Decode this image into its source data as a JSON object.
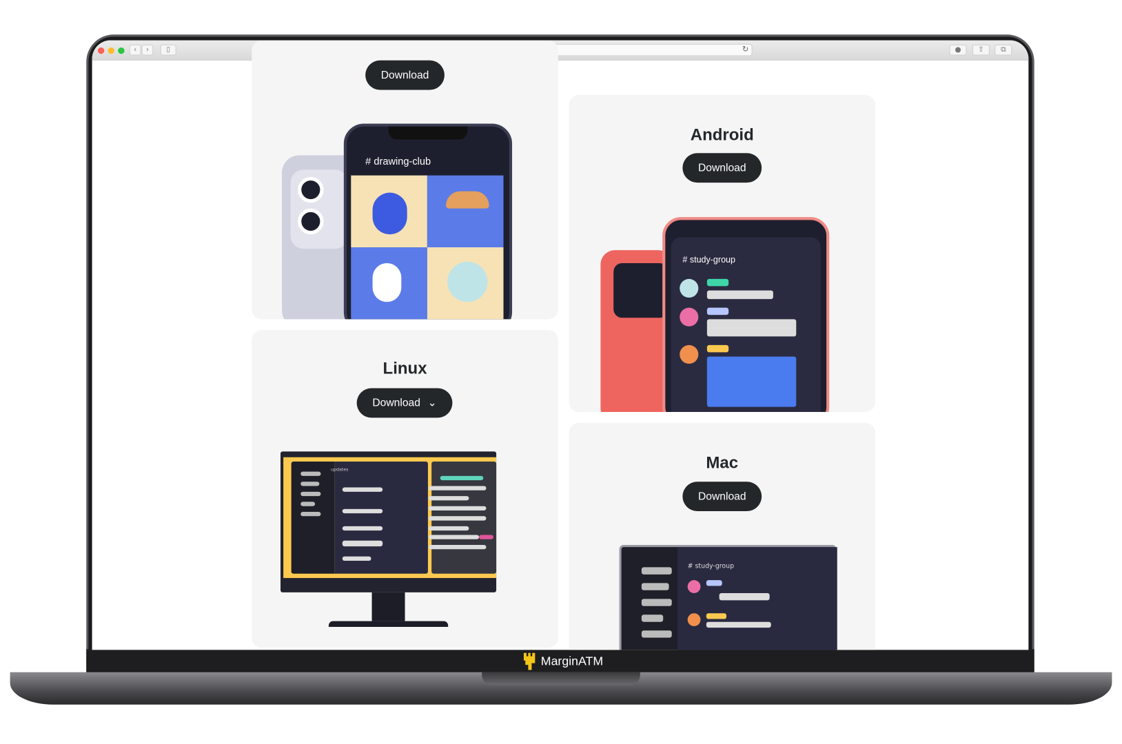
{
  "browser": {
    "back": "‹",
    "forward": "›",
    "reload": "↻"
  },
  "cards": {
    "ios": {
      "button": "Download",
      "channel": "drawing-club"
    },
    "android": {
      "title": "Android",
      "button": "Download",
      "channel": "study-group"
    },
    "linux": {
      "title": "Linux",
      "button": "Download",
      "channel": "updates"
    },
    "mac": {
      "title": "Mac",
      "button": "Download",
      "channel": "study-group"
    }
  },
  "watermark": {
    "text": "MarginATM"
  },
  "colors": {
    "button": "#23272a",
    "card": "#f5f5f5",
    "accent_yellow": "#fcc94f",
    "brand_blurple": "#5865f2"
  }
}
